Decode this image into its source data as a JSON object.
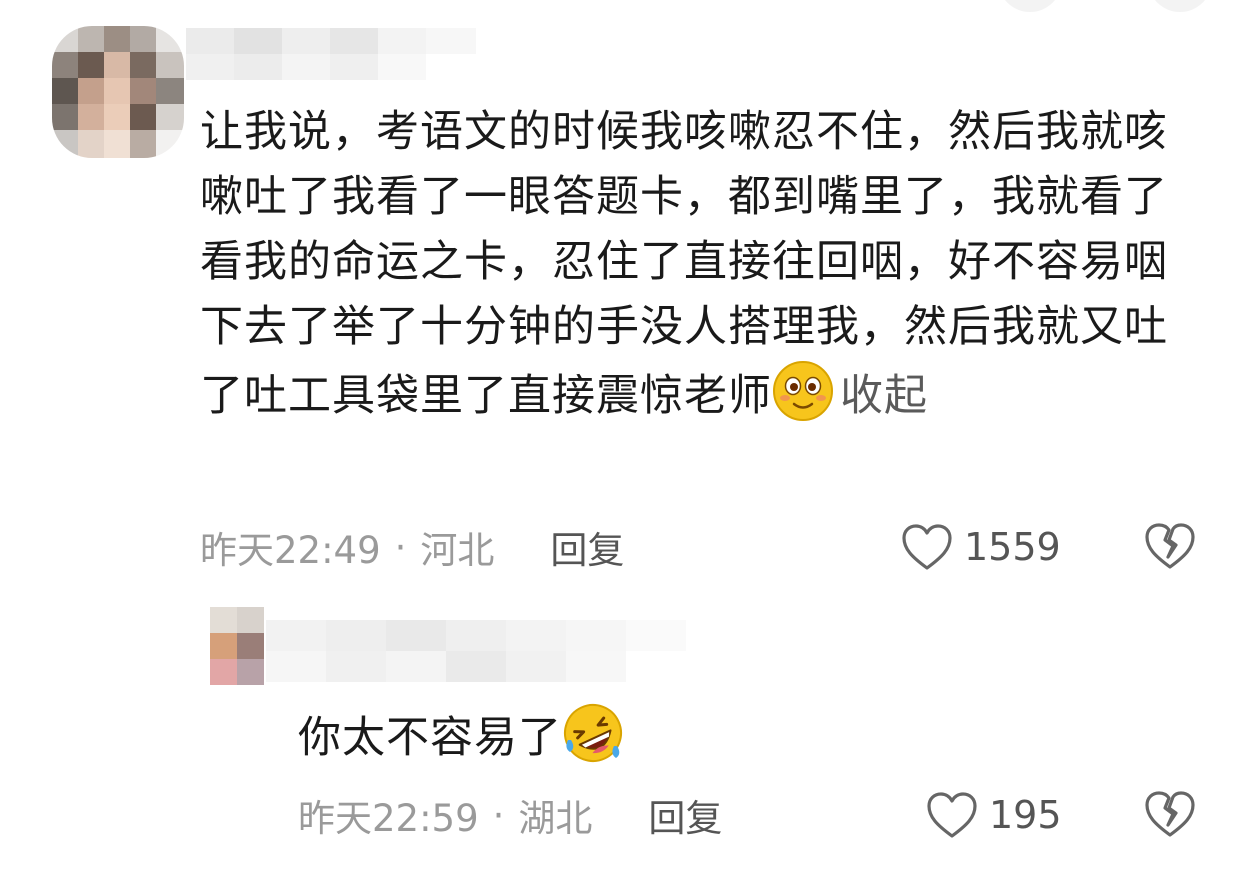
{
  "comment": {
    "text": "让我说，考语文的时候我咳嗽忍不住，然后我就咳嗽吐了我看了一眼答题卡，都到嘴里了，我就看了看我的命运之卡，忍住了直接往回咽，好不容易咽下去了举了十分钟的手没人搭理我，然后我就又吐了吐工具袋里了直接震惊老师",
    "emoji_icon": "grinning-blush-emoji",
    "collapse_label": "收起",
    "time": "昨天22:49",
    "separator": "·",
    "location": "河北",
    "reply_label": "回复",
    "like_count": "1559"
  },
  "reply": {
    "text": "你太不容易了",
    "emoji_icon": "rofl-tears-emoji",
    "time": "昨天22:59",
    "separator": "·",
    "location": "湖北",
    "reply_label": "回复",
    "like_count": "195"
  },
  "colors": {
    "text_primary": "#1a1a1a",
    "text_meta": "#9a9a9a",
    "text_action": "#555555",
    "emoji_yellow": "#f7c51c",
    "icon_gray": "#666666"
  }
}
